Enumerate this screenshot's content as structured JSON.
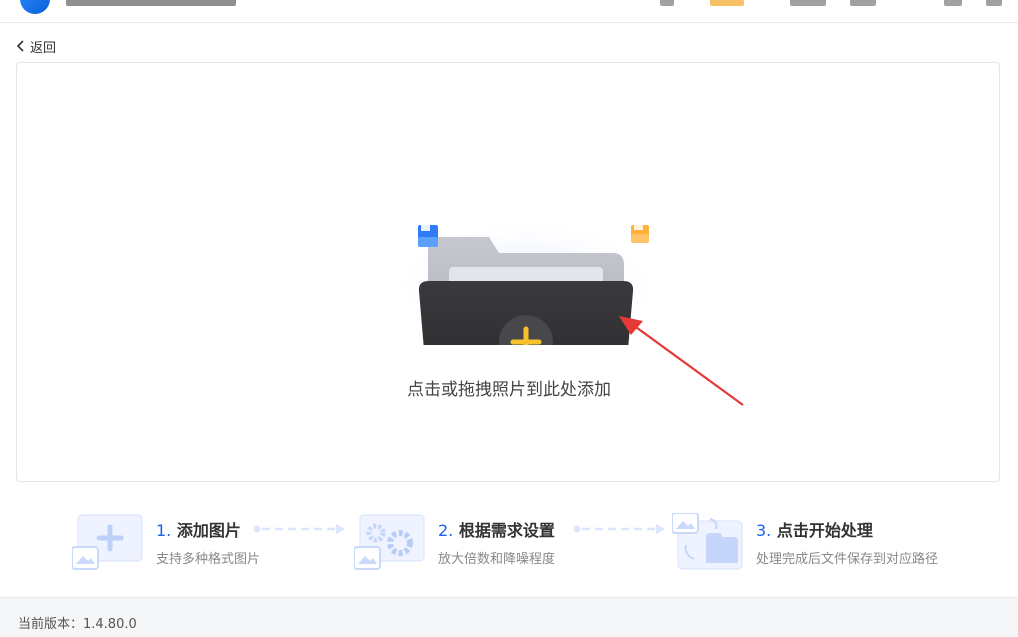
{
  "nav": {
    "back_label": "返回"
  },
  "dropzone": {
    "hint": "点击或拖拽照片到此处添加"
  },
  "steps": [
    {
      "number": "1.",
      "title": "添加图片",
      "desc": "支持多种格式图片"
    },
    {
      "number": "2.",
      "title": "根据需求设置",
      "desc": "放大倍数和降噪程度"
    },
    {
      "number": "3.",
      "title": "点击开始处理",
      "desc": "处理完成后文件保存到对应路径"
    }
  ],
  "footer": {
    "version_label": "当前版本：1.4.80.0"
  },
  "colors": {
    "accent": "#1b63f0",
    "plus": "#f6c22a",
    "arrow": "#e53935",
    "folder_dark": "#2e2e31"
  }
}
